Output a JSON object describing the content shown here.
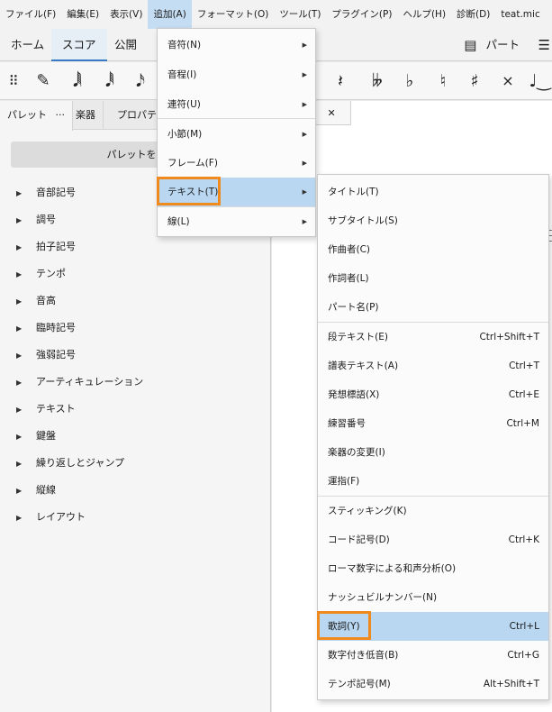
{
  "menubar": {
    "items": [
      {
        "label": "ファイル(F)"
      },
      {
        "label": "編集(E)"
      },
      {
        "label": "表示(V)"
      },
      {
        "label": "追加(A)"
      },
      {
        "label": "フォーマット(O)"
      },
      {
        "label": "ツール(T)"
      },
      {
        "label": "プラグイン(P)"
      },
      {
        "label": "ヘルプ(H)"
      },
      {
        "label": "診断(D)"
      },
      {
        "label": "teat.mic"
      }
    ]
  },
  "workspace_tabs": {
    "home": "ホーム",
    "score": "スコア",
    "publish": "公開",
    "parts": "パート"
  },
  "toolbar": {
    "icons": [
      "grip-icon",
      "pencil-icon",
      "sixty-fourth-note-icon",
      "thirty-second-note-icon",
      "sixteenth-note-icon",
      "rest-icon",
      "double-flat-icon",
      "flat-icon",
      "natural-icon",
      "sharp-icon",
      "double-sharp-icon",
      "tie-icon"
    ],
    "glyphs": {
      "grip": "⠿",
      "pencil": "✎",
      "note64": "𝅘𝅥𝅲",
      "note32": "𝅘𝅥𝅱",
      "note16": "𝅘𝅥𝅯",
      "rest": "𝄽",
      "dflat": "𝄫",
      "flat": "♭",
      "natural": "♮",
      "sharp": "♯",
      "dsharp": "×",
      "tie": "♩‿"
    }
  },
  "left_panel": {
    "tabs": {
      "palette": "パレット",
      "palette_more": "···",
      "instruments": "楽器",
      "properties": "プロパティ"
    },
    "add_palette_button": "パレットを追加",
    "items": [
      {
        "label": "音部記号"
      },
      {
        "label": "調号"
      },
      {
        "label": "拍子記号"
      },
      {
        "label": "テンポ"
      },
      {
        "label": "音高"
      },
      {
        "label": "臨時記号"
      },
      {
        "label": "強弱記号"
      },
      {
        "label": "アーティキュレーション"
      },
      {
        "label": "テキスト"
      },
      {
        "label": "鍵盤"
      },
      {
        "label": "繰り返しとジャンプ"
      },
      {
        "label": "縦線"
      },
      {
        "label": "レイアウト"
      }
    ],
    "expand_arrow": "▶"
  },
  "score_tab": {
    "label": "id",
    "close": "✕"
  },
  "add_menu": {
    "items": [
      {
        "label": "音符(N)"
      },
      {
        "label": "音程(I)"
      },
      {
        "label": "連符(U)"
      },
      {
        "label": "小節(M)"
      },
      {
        "label": "フレーム(F)"
      },
      {
        "label": "テキスト(T)"
      },
      {
        "label": "線(L)"
      }
    ],
    "submenu_arrow": "▶"
  },
  "text_submenu": {
    "items": [
      {
        "label": "タイトル(T)",
        "shortcut": ""
      },
      {
        "label": "サブタイトル(S)",
        "shortcut": ""
      },
      {
        "label": "作曲者(C)",
        "shortcut": ""
      },
      {
        "label": "作詞者(L)",
        "shortcut": ""
      },
      {
        "label": "パート名(P)",
        "shortcut": ""
      },
      {
        "label": "段テキスト(E)",
        "shortcut": "Ctrl+Shift+T"
      },
      {
        "label": "譜表テキスト(A)",
        "shortcut": "Ctrl+T"
      },
      {
        "label": "発想標語(X)",
        "shortcut": "Ctrl+E"
      },
      {
        "label": "練習番号",
        "shortcut": "Ctrl+M"
      },
      {
        "label": "楽器の変更(I)",
        "shortcut": ""
      },
      {
        "label": "運指(F)",
        "shortcut": ""
      },
      {
        "label": "スティッキング(K)",
        "shortcut": ""
      },
      {
        "label": "コード記号(D)",
        "shortcut": "Ctrl+K"
      },
      {
        "label": "ローマ数字による和声分析(O)",
        "shortcut": ""
      },
      {
        "label": "ナッシュビルナンバー(N)",
        "shortcut": ""
      },
      {
        "label": "歌詞(Y)",
        "shortcut": "Ctrl+L"
      },
      {
        "label": "数字付き低音(B)",
        "shortcut": "Ctrl+G"
      },
      {
        "label": "テンポ記号(M)",
        "shortcut": "Alt+Shift+T"
      }
    ]
  },
  "colors": {
    "highlight_box": "#f08a1c",
    "menu_hover": "#b9d7f1",
    "active_menu": "#c5ddf3"
  }
}
